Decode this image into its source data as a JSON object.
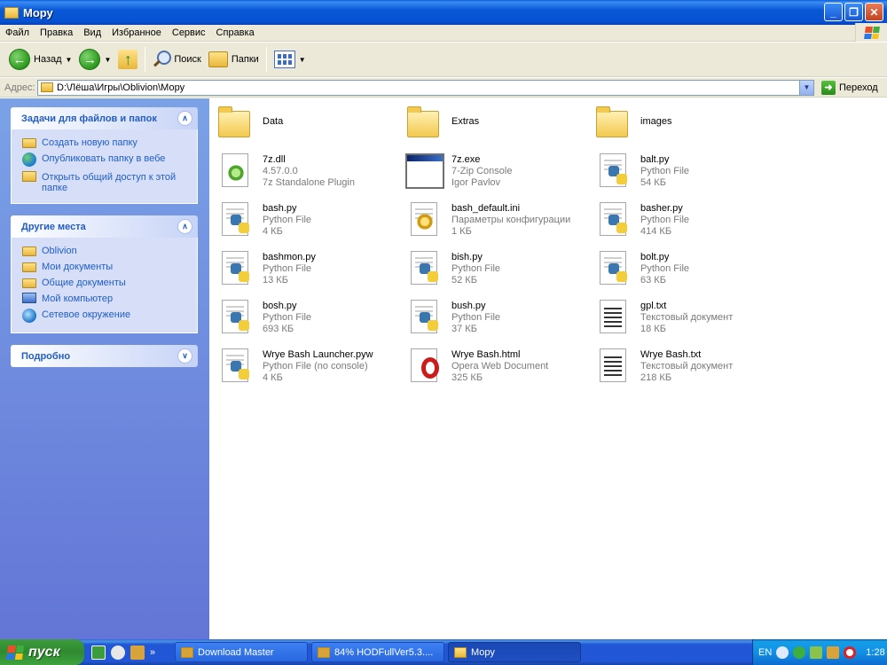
{
  "window": {
    "title": "Мору",
    "buttons": {
      "minimize": "_",
      "maximize": "❐",
      "close": "✕"
    }
  },
  "menu": [
    "Файл",
    "Правка",
    "Вид",
    "Избранное",
    "Сервис",
    "Справка"
  ],
  "toolbar": {
    "back_label": "Назад",
    "search_label": "Поиск",
    "folders_label": "Папки"
  },
  "address": {
    "label": "Адрес:",
    "value": "D:\\Лёша\\Игры\\Oblivion\\Мору",
    "go_label": "Переход"
  },
  "sidebar": {
    "tasks": {
      "title": "Задачи для файлов и папок",
      "items": [
        {
          "label": "Создать новую папку",
          "icon": "new-folder-icon"
        },
        {
          "label": "Опубликовать папку в вебе",
          "icon": "globe-icon"
        },
        {
          "label": "Открыть общий доступ к этой папке",
          "icon": "share-icon"
        }
      ]
    },
    "places": {
      "title": "Другие места",
      "items": [
        {
          "label": "Oblivion",
          "icon": "folder-icon"
        },
        {
          "label": "Мои документы",
          "icon": "folder-icon"
        },
        {
          "label": "Общие документы",
          "icon": "folder-icon"
        },
        {
          "label": "Мой компьютер",
          "icon": "computer-icon"
        },
        {
          "label": "Сетевое окружение",
          "icon": "network-icon"
        }
      ]
    },
    "details": {
      "title": "Подробно"
    }
  },
  "files": [
    {
      "name": "Data",
      "line2": "",
      "line3": "",
      "icon": "folder"
    },
    {
      "name": "Extras",
      "line2": "",
      "line3": "",
      "icon": "folder"
    },
    {
      "name": "images",
      "line2": "",
      "line3": "",
      "icon": "folder"
    },
    {
      "name": "7z.dll",
      "line2": "4.57.0.0",
      "line3": "7z Standalone Plugin",
      "icon": "dll"
    },
    {
      "name": "7z.exe",
      "line2": "7-Zip Console",
      "line3": "Igor Pavlov",
      "icon": "console"
    },
    {
      "name": "balt.py",
      "line2": "Python File",
      "line3": "54 КБ",
      "icon": "python"
    },
    {
      "name": "bash.py",
      "line2": "Python File",
      "line3": "4 КБ",
      "icon": "python"
    },
    {
      "name": "bash_default.ini",
      "line2": "Параметры конфигурации",
      "line3": "1 КБ",
      "icon": "ini"
    },
    {
      "name": "basher.py",
      "line2": "Python File",
      "line3": "414 КБ",
      "icon": "python"
    },
    {
      "name": "bashmon.py",
      "line2": "Python File",
      "line3": "13 КБ",
      "icon": "python"
    },
    {
      "name": "bish.py",
      "line2": "Python File",
      "line3": "52 КБ",
      "icon": "python"
    },
    {
      "name": "bolt.py",
      "line2": "Python File",
      "line3": "63 КБ",
      "icon": "python"
    },
    {
      "name": "bosh.py",
      "line2": "Python File",
      "line3": "693 КБ",
      "icon": "python"
    },
    {
      "name": "bush.py",
      "line2": "Python File",
      "line3": "37 КБ",
      "icon": "python"
    },
    {
      "name": "gpl.txt",
      "line2": "Текстовый документ",
      "line3": "18 КБ",
      "icon": "text"
    },
    {
      "name": "Wrye Bash Launcher.pyw",
      "line2": "Python File (no console)",
      "line3": "4 КБ",
      "icon": "python"
    },
    {
      "name": "Wrye Bash.html",
      "line2": "Opera Web Document",
      "line3": "325 КБ",
      "icon": "opera"
    },
    {
      "name": "Wrye Bash.txt",
      "line2": "Текстовый документ",
      "line3": "218 КБ",
      "icon": "text"
    }
  ],
  "taskbar": {
    "start_label": "пуск",
    "tasks": [
      {
        "label": "Download Master",
        "active": false
      },
      {
        "label": "84% HODFullVer5.3....",
        "active": false
      },
      {
        "label": "Мору",
        "active": true
      }
    ],
    "tray": {
      "lang": "EN",
      "time": "1:28"
    }
  },
  "colors": {
    "titlebar": "#0a58d6",
    "sidebar": "#7ba2e7",
    "link": "#215dc6",
    "taskbar": "#2157d7",
    "start": "#3c9b3c"
  }
}
